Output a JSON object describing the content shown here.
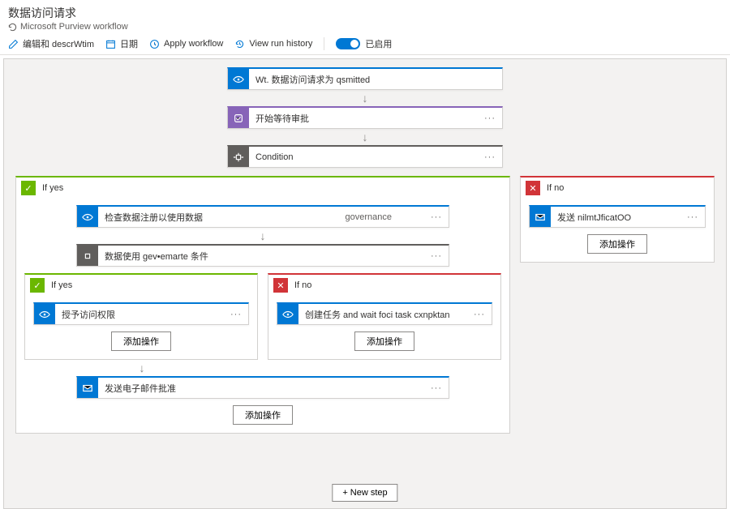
{
  "header": {
    "title": "数据访问请求",
    "subtitle": "Microsoft Purview workflow"
  },
  "toolbar": {
    "edit": "编辑和 descrWtim",
    "date": "日期",
    "apply": "Apply workflow",
    "history": "View run history",
    "enabled": "已启用"
  },
  "flow": {
    "trigger": "Wt. 数据访问请求为 qsmitted",
    "approval": "开始等待审批",
    "condition": "Condition",
    "ifyes": "If yes",
    "ifno": "If no",
    "check": {
      "label": "检查数据注册以使用数据",
      "sub": "governance"
    },
    "datause": "数据使用 gev•emarte 条件",
    "grant": "授予访问权限",
    "createtask": "创建任务 and wait foci task cxnpktan",
    "sendemail": "发送电子邮件批准",
    "sendnotif": "发送 nilmtJficatOO",
    "addop": "添加操作",
    "newstep": "+ New step"
  }
}
